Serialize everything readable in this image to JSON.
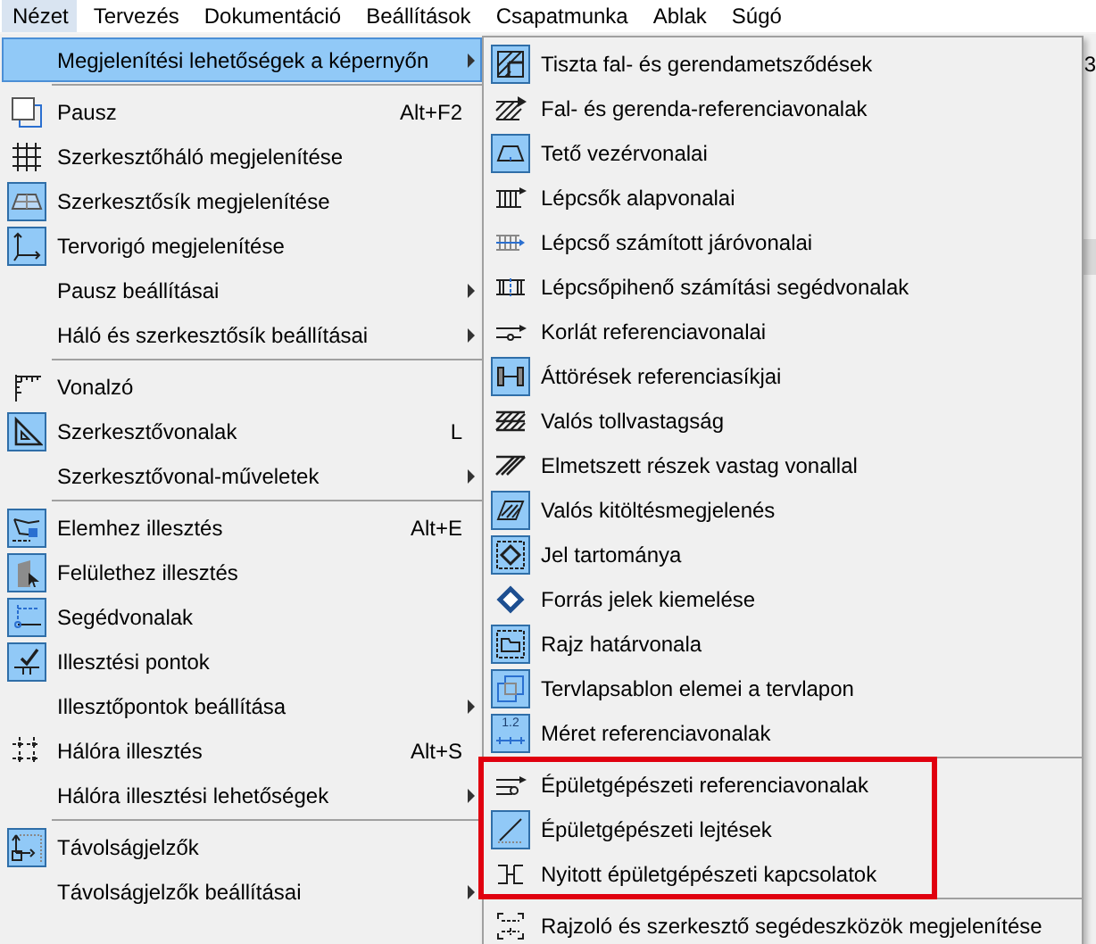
{
  "menubar": [
    {
      "label": "Nézet",
      "selected": true
    },
    {
      "label": "Tervezés",
      "selected": false
    },
    {
      "label": "Dokumentáció",
      "selected": false
    },
    {
      "label": "Beállítások",
      "selected": false
    },
    {
      "label": "Csapatmunka",
      "selected": false
    },
    {
      "label": "Ablak",
      "selected": false
    },
    {
      "label": "Súgó",
      "selected": false
    }
  ],
  "background_window": {
    "text": "3"
  },
  "menu": {
    "sections": [
      {
        "items": [
          {
            "label": "Megjelenítési lehetőségek a képernyőn",
            "has_submenu": true,
            "checked": false,
            "selected": true
          }
        ]
      },
      {
        "items": [
          {
            "label": "Pausz",
            "shortcut": "Alt+F2",
            "has_submenu": false,
            "checked": false,
            "selected": false
          },
          {
            "label": "Szerkesztőháló megjelenítése",
            "has_submenu": false,
            "checked": false,
            "selected": false
          },
          {
            "label": "Szerkesztősík megjelenítése",
            "has_submenu": false,
            "checked": true,
            "selected": false
          },
          {
            "label": "Tervorigó megjelenítése",
            "has_submenu": false,
            "checked": true,
            "selected": false
          },
          {
            "label": "Pausz beállításai",
            "has_submenu": true,
            "checked": false,
            "selected": false
          },
          {
            "label": "Háló és szerkesztősík beállításai",
            "has_submenu": true,
            "checked": false,
            "selected": false
          }
        ]
      },
      {
        "items": [
          {
            "label": "Vonalzó",
            "has_submenu": false,
            "checked": false,
            "selected": false
          },
          {
            "label": "Szerkesztővonalak",
            "shortcut": "L",
            "has_submenu": false,
            "checked": true,
            "selected": false
          },
          {
            "label": "Szerkesztővonal-műveletek",
            "has_submenu": true,
            "checked": false,
            "selected": false
          }
        ]
      },
      {
        "items": [
          {
            "label": "Elemhez illesztés",
            "shortcut": "Alt+E",
            "has_submenu": false,
            "checked": true,
            "selected": false
          },
          {
            "label": "Felülethez illesztés",
            "has_submenu": false,
            "checked": true,
            "selected": false
          },
          {
            "label": "Segédvonalak",
            "has_submenu": false,
            "checked": true,
            "selected": false
          },
          {
            "label": "Illesztési pontok",
            "has_submenu": false,
            "checked": true,
            "selected": false
          },
          {
            "label": "Illesztőpontok beállítása",
            "has_submenu": true,
            "checked": false,
            "selected": false
          },
          {
            "label": "Hálóra illesztés",
            "shortcut": "Alt+S",
            "has_submenu": false,
            "checked": false,
            "selected": false
          },
          {
            "label": "Hálóra illesztési lehetőségek",
            "has_submenu": true,
            "checked": false,
            "selected": false
          }
        ]
      },
      {
        "items": [
          {
            "label": "Távolságjelzők",
            "has_submenu": false,
            "checked": true,
            "selected": false
          },
          {
            "label": "Távolságjelzők beállításai",
            "has_submenu": true,
            "checked": false,
            "selected": false
          }
        ]
      }
    ]
  },
  "submenu": {
    "sections": [
      {
        "highlighted": false,
        "items": [
          {
            "label": "Tiszta fal- és gerendametsződések",
            "checked": true,
            "selected": false
          },
          {
            "label": "Fal- és gerenda-referenciavonalak",
            "checked": false,
            "selected": false
          },
          {
            "label": "Tető vezérvonalai",
            "checked": true,
            "selected": false
          },
          {
            "label": "Lépcsők alapvonalai",
            "checked": false,
            "selected": false
          },
          {
            "label": "Lépcső számított járóvonalai",
            "checked": false,
            "selected": false
          },
          {
            "label": "Lépcsőpihenő számítási segédvonalak",
            "checked": false,
            "selected": false
          },
          {
            "label": "Korlát referenciavonalai",
            "checked": false,
            "selected": false
          },
          {
            "label": "Áttörések referenciasíkjai",
            "checked": true,
            "selected": false
          },
          {
            "label": "Valós tollvastagság",
            "checked": false,
            "selected": false
          },
          {
            "label": "Elmetszett részek vastag vonallal",
            "checked": false,
            "selected": false
          },
          {
            "label": "Valós kitöltésmegjelenés",
            "checked": true,
            "selected": false
          },
          {
            "label": "Jel tartománya",
            "checked": true,
            "selected": false
          },
          {
            "label": "Forrás jelek kiemelése",
            "checked": false,
            "selected": false
          },
          {
            "label": "Rajz határvonala",
            "checked": true,
            "selected": false
          },
          {
            "label": "Tervlapsablon elemei a tervlapon",
            "checked": true,
            "selected": false
          },
          {
            "label": "Méret referenciavonalak",
            "icon_text": "1.2",
            "checked": true,
            "selected": false
          }
        ]
      },
      {
        "highlighted": true,
        "items": [
          {
            "label": "Épületgépészeti referenciavonalak",
            "checked": false,
            "selected": false
          },
          {
            "label": "Épületgépészeti lejtések",
            "checked": true,
            "selected": false
          },
          {
            "label": "Nyitott épületgépészeti kapcsolatok",
            "checked": false,
            "selected": false
          }
        ]
      },
      {
        "highlighted": false,
        "items": [
          {
            "label": "Rajzoló és szerkesztő segédeszközök megjelenítése",
            "checked": false,
            "selected": false
          }
        ]
      }
    ]
  }
}
